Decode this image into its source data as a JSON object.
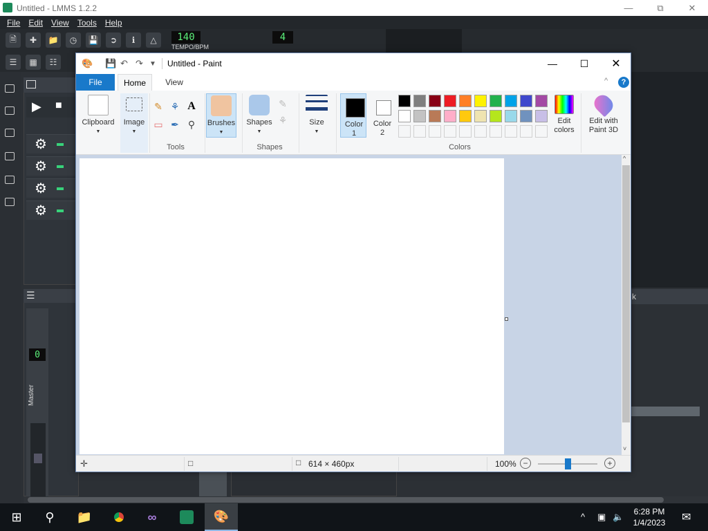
{
  "lmms": {
    "title": "Untitled - LMMS 1.2.2",
    "menu": [
      "File",
      "Edit",
      "View",
      "Tools",
      "Help"
    ],
    "tempo_value": "140",
    "tempo_label": "TEMPO/BPM",
    "time_sig_top": "4",
    "mixer_channel": "0",
    "master_label": "Master",
    "right_header": "k"
  },
  "paint": {
    "title": "Untitled - Paint",
    "tabs": {
      "file": "File",
      "home": "Home",
      "view": "View"
    },
    "ribbon": {
      "clipboard": "Clipboard",
      "image": "Image",
      "tools_group": "Tools",
      "brushes": "Brushes",
      "shapes": "Shapes",
      "shapes_group": "Shapes",
      "size": "Size",
      "color1_line1": "Color",
      "color1_line2": "1",
      "color2_line1": "Color",
      "color2_line2": "2",
      "colors_group": "Colors",
      "edit_colors_line1": "Edit",
      "edit_colors_line2": "colors",
      "edit_paint3d_line1": "Edit with",
      "edit_paint3d_line2": "Paint 3D"
    },
    "palette_row1": [
      "#000000",
      "#7f7f7f",
      "#880015",
      "#ed1c24",
      "#ff7f27",
      "#fff200",
      "#22b14c",
      "#00a2e8",
      "#3f48cc",
      "#a349a4"
    ],
    "palette_row2": [
      "#ffffff",
      "#c3c3c3",
      "#b97a57",
      "#ffaec9",
      "#ffc90e",
      "#efe4b0",
      "#b5e61d",
      "#99d9ea",
      "#7092be",
      "#c8bfe7"
    ],
    "color1": "#000000",
    "color2": "#ffffff",
    "status": {
      "canvas_size": "614 × 460px",
      "zoom": "100%"
    }
  },
  "taskbar": {
    "time": "6:28 PM",
    "date": "1/4/2023"
  }
}
